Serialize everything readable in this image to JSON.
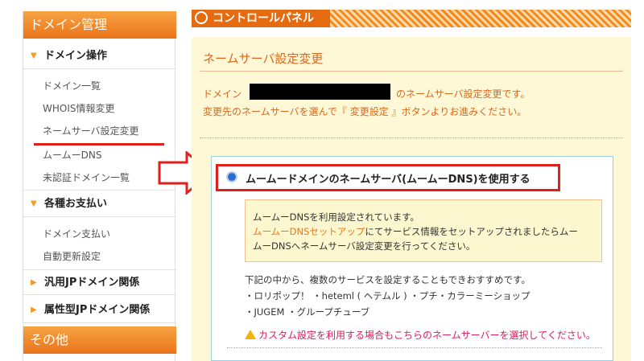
{
  "sidebar": {
    "header": "ドメイン管理",
    "group1": "ドメイン操作",
    "items": [
      "ドメイン一覧",
      "WHOIS情報変更",
      "ネームサーバ設定変更",
      "ムームーDNS",
      "未認証ドメイン一覧"
    ],
    "group2": "各種お支払い",
    "items2": [
      "ドメイン支払い",
      "自動更新設定"
    ],
    "group3": "汎用JPドメイン関係",
    "group4": "属性型JPドメイン関係",
    "header2": "その他"
  },
  "main": {
    "bar_title": "コントロールパネル",
    "panel_title": "ネームサーバ設定変更",
    "notice_prefix": "ドメイン",
    "notice_suffix": "のネームサーバ設定変更です。",
    "notice_line2": "変更先のネームサーバを選んで『 変更設定 』ボタンよりお進みください。",
    "radio_label": "ムームードメインのネームサーバ(ムームーDNS)を使用する",
    "info_line1": "ムームーDNSを利用設定されています。",
    "info_link": "ムームーDNSセットアップ",
    "info_line2_rest": "にてサービス情報をセットアップされましたらムー",
    "info_line3": "ムーDNSへネームサーバ設定変更を行ってください。",
    "services_intro": "下記の中から、複数のサービスを設定することもできおすすめです。",
    "services_line1": "・ロリポップ！ ・heteml ( ヘテムル ) ・プチ・カラーミーショップ",
    "services_line2": "・JUGEM ・グループチューブ",
    "warn_link": "カスタム設定",
    "warn_rest": "を利用する場合もこちらのネームサーバーを選択してください。"
  },
  "colors": {
    "accent": "#e66a10",
    "highlight_red": "#e0201c",
    "radio_blue": "#2a6fd0"
  }
}
